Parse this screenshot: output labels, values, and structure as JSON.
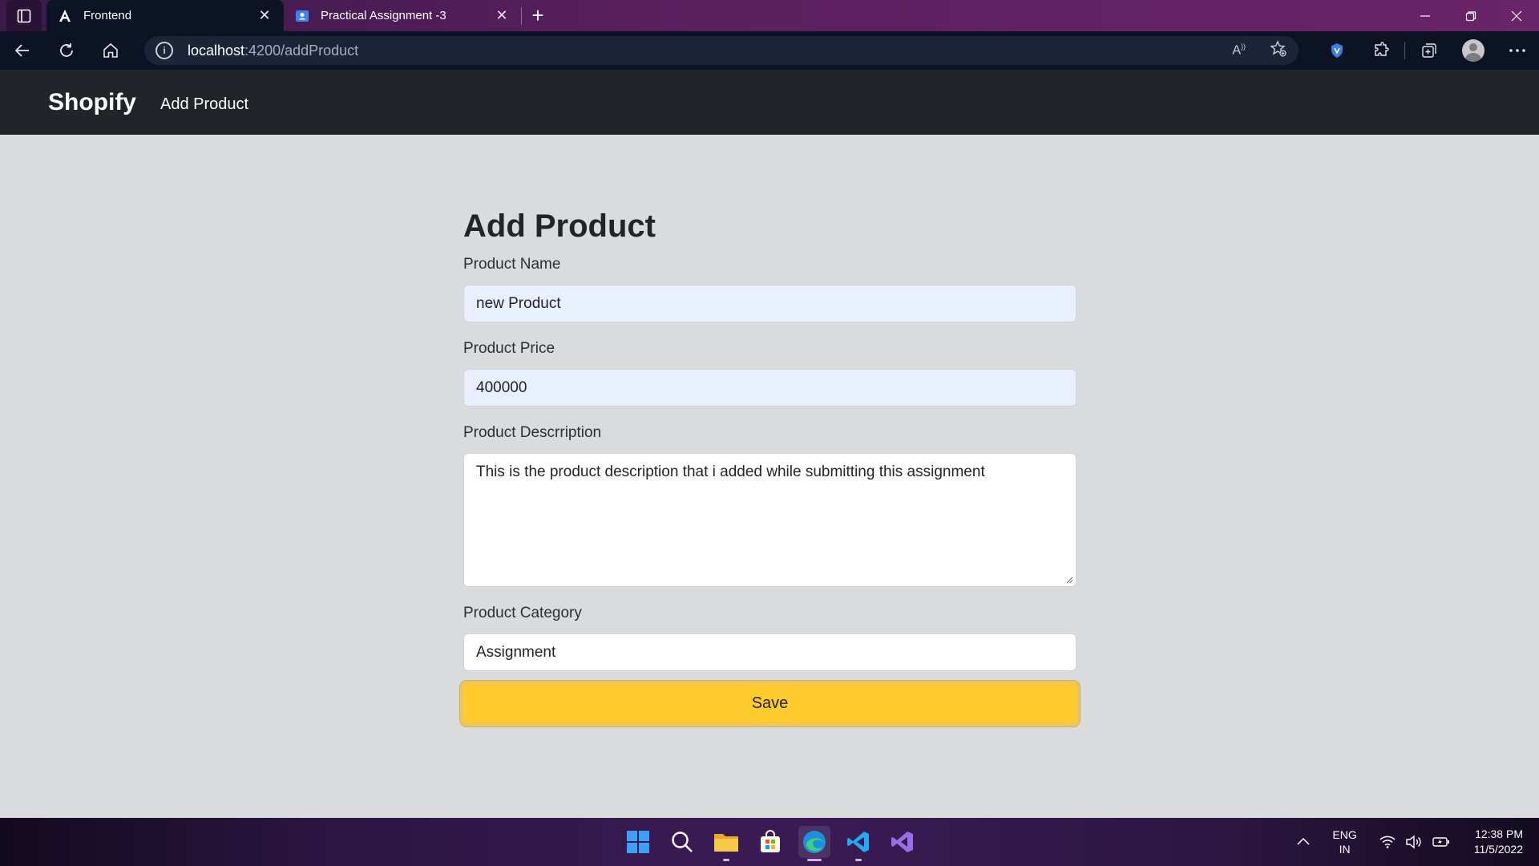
{
  "browser": {
    "tabs": [
      {
        "title": "Frontend",
        "icon": "angular-icon",
        "active": true
      },
      {
        "title": "Practical Assignment -3",
        "icon": "classroom-icon",
        "active": false
      }
    ],
    "address": {
      "host": "localhost",
      "path": ":4200/addProduct"
    }
  },
  "app": {
    "brand": "Shopify",
    "nav_link": "Add Product"
  },
  "form": {
    "title": "Add Product",
    "name_label": "Product Name",
    "name_value": "new Product",
    "price_label": "Product Price",
    "price_value": "400000",
    "description_label": "Product Descrription",
    "description_value": "This is the product description that i added while submitting this assignment",
    "category_label": "Product Category",
    "category_value": "Assignment",
    "save_label": "Save"
  },
  "taskbar": {
    "lang_top": "ENG",
    "lang_bottom": "IN",
    "time": "12:38 PM",
    "date": "11/5/2022"
  },
  "colors": {
    "accent": "#ffca2c",
    "navbar": "#212529",
    "page_bg": "#dadbdd"
  }
}
